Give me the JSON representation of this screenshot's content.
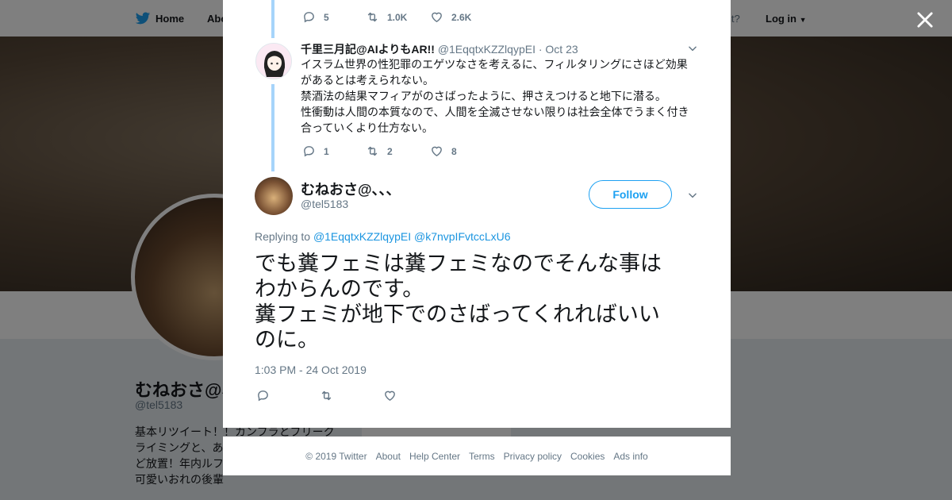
{
  "background": {
    "nav": {
      "home_label": "Home",
      "about_label": "Abo",
      "account_text": "account?",
      "login_label": "Log in"
    },
    "profile": {
      "name": "むねおさ@、",
      "handle": "@tel5183",
      "bio_lines": [
        "基本リツイート！！カンフラとブリーク",
        "ライミングと、あ",
        "ど放置！年内ルフ",
        "可愛いおれの後輩"
      ],
      "card_text": "Ads info"
    }
  },
  "prev_tweet": {
    "actions": {
      "replies": "5",
      "retweets": "1.0K",
      "likes": "2.6K"
    }
  },
  "reply_tweet": {
    "name": "千里三月記@AIよりもAR!!",
    "handle": "@1EqqtxKZZlqypEI",
    "date": "· Oct 23",
    "lines": [
      "イスラム世界の性犯罪のエゲツなさを考えるに、フィルタリングにさほど効果",
      "があるとは考えられない。",
      "禁酒法の結果マフィアがのさばったように、押さえつけると地下に潜る。",
      "性衝動は人間の本質なので、人間を全滅させない限りは社会全体でうまく付き",
      "合っていくより仕方ない。"
    ],
    "actions": {
      "replies": "1",
      "retweets": "2",
      "likes": "8"
    }
  },
  "main_tweet": {
    "name": "むねおさ@、、、",
    "handle": "@tel5183",
    "follow_label": "Follow",
    "replying_prefix": "Replying to",
    "replying_to": [
      "@1EqqtxKZZlqypEI",
      "@k7nvpIFvtccLxU6"
    ],
    "lines": [
      "でも糞フェミは糞フェミなのでそんな事は",
      "わからんのです。",
      "糞フェミが地下でのさばってくれればいい",
      "のに。"
    ],
    "timestamp": "1:03 PM - 24 Oct 2019"
  },
  "footer": {
    "links": [
      "© 2019 Twitter",
      "About",
      "Help Center",
      "Terms",
      "Privacy policy",
      "Cookies",
      "Ads info"
    ]
  },
  "colors": {
    "accent": "#1da1f2",
    "thread_line": "#a6d4fa",
    "muted": "#657786"
  }
}
